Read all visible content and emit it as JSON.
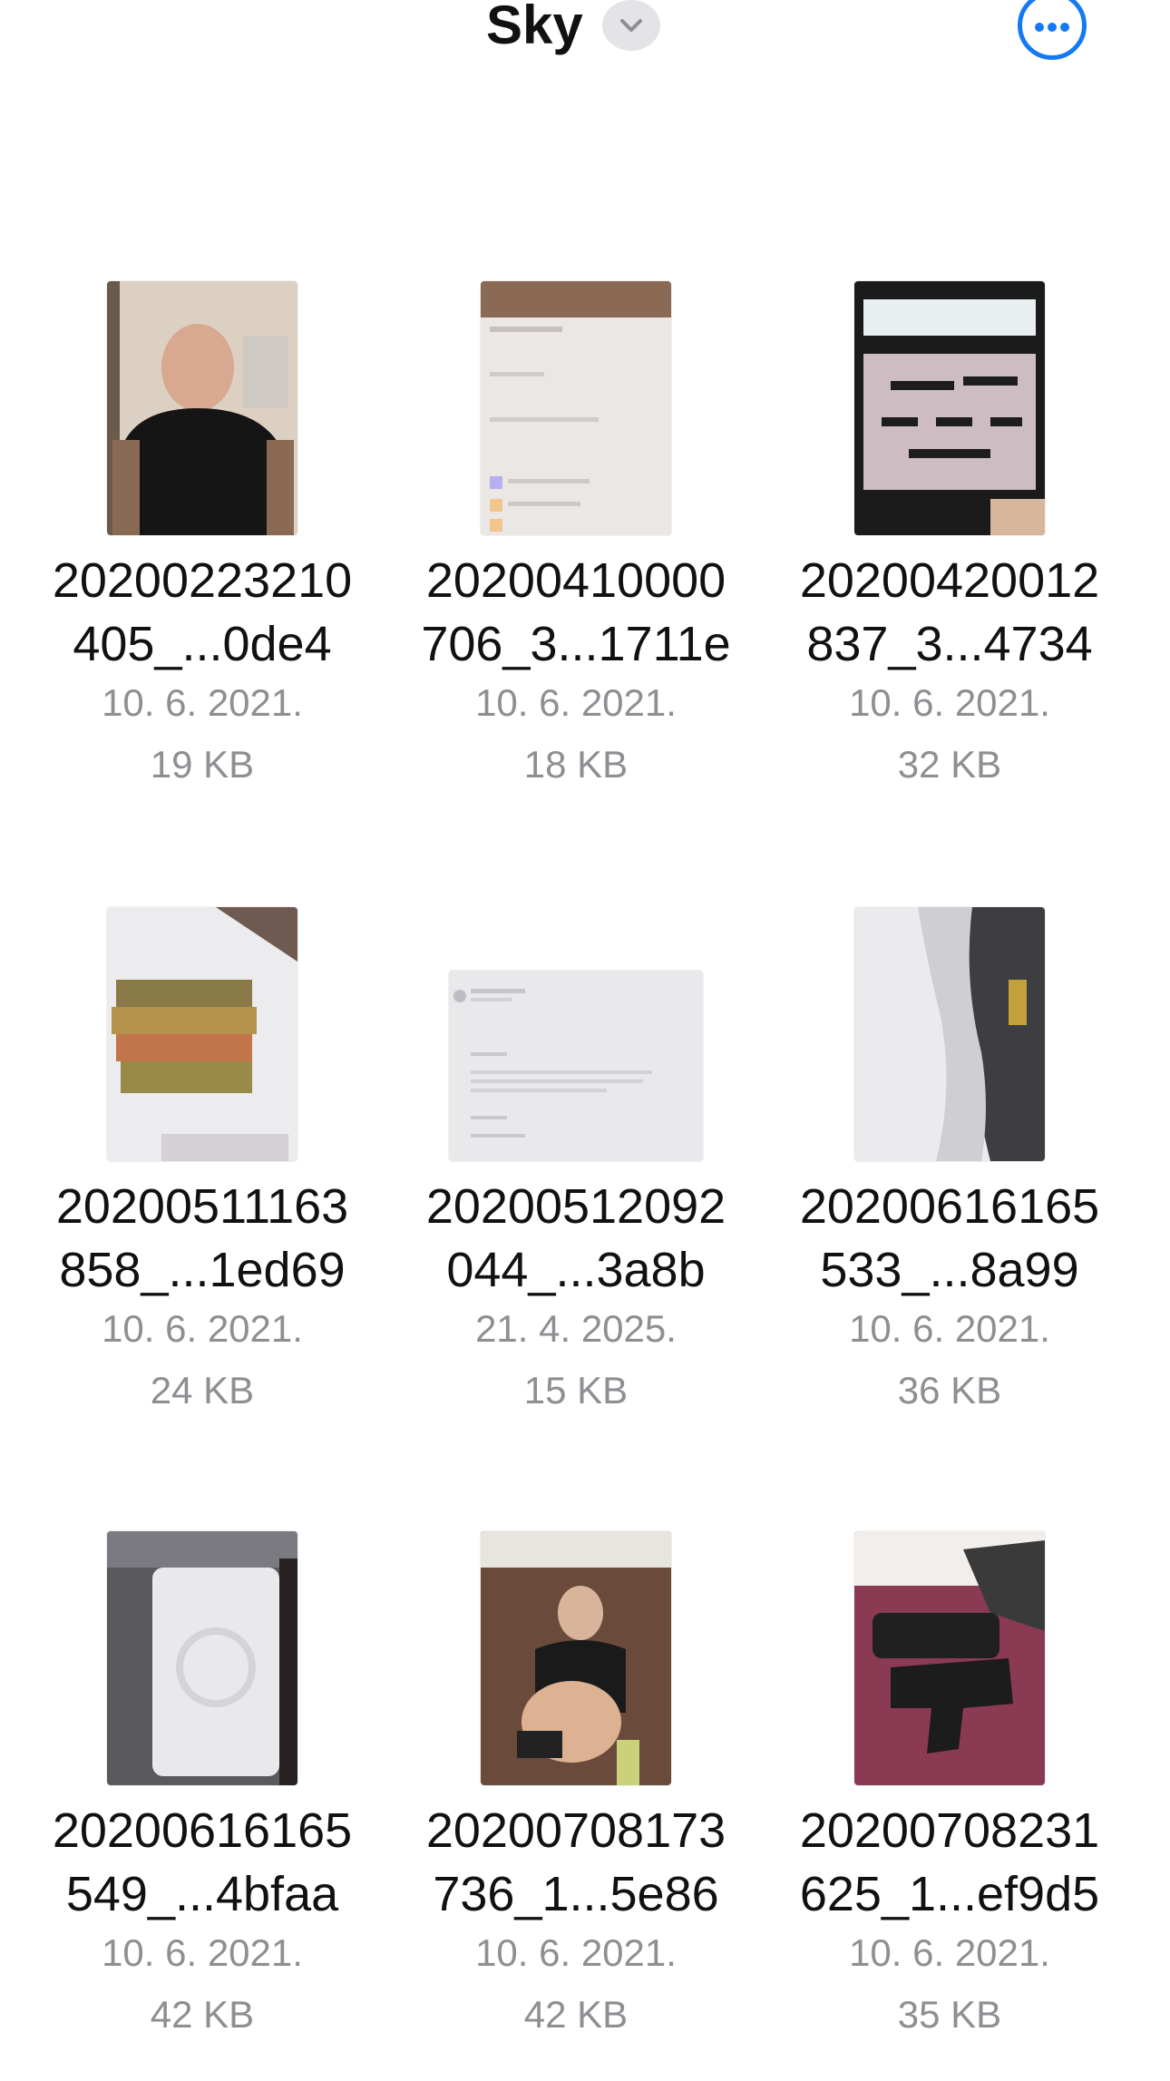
{
  "header": {
    "title": "Sky",
    "chevron_icon": "chevron-down-icon",
    "more_icon": "ellipsis-circle-icon",
    "accent_color": "#1479f5"
  },
  "files": [
    {
      "name_line1": "20200223210",
      "name_line2": "405_...0de4",
      "date": "10. 6. 2021.",
      "size": "19 KB",
      "thumbnail": "selfie-man-black-tshirt"
    },
    {
      "name_line1": "20200410000",
      "name_line2": "706_3...1711e",
      "date": "10. 6. 2021.",
      "size": "18 KB",
      "thumbnail": "phone-chat-screenshot"
    },
    {
      "name_line1": "20200420012",
      "name_line2": "837_3...4734",
      "date": "10. 6. 2021.",
      "size": "32 KB",
      "thumbnail": "phone-photo-weapons"
    },
    {
      "name_line1": "20200511163",
      "name_line2": "858_...1ed69",
      "date": "10. 6. 2021.",
      "size": "24 KB",
      "thumbnail": "cash-bundles"
    },
    {
      "name_line1": "20200512092",
      "name_line2": "044_...3a8b",
      "date": "21. 4. 2025.",
      "size": "15 KB",
      "thumbnail": "email-screenshot"
    },
    {
      "name_line1": "20200616165",
      "name_line2": "533_...8a99",
      "date": "10. 6. 2021.",
      "size": "36 KB",
      "thumbnail": "white-powder-block"
    },
    {
      "name_line1": "20200616165",
      "name_line2": "549_...4bfaa",
      "date": "10. 6. 2021.",
      "size": "42 KB",
      "thumbnail": "pressed-brick"
    },
    {
      "name_line1": "20200708173",
      "name_line2": "736_1...5e86",
      "date": "10. 6. 2021.",
      "size": "42 KB",
      "thumbnail": "bar-selfie-man"
    },
    {
      "name_line1": "20200708231",
      "name_line2": "625_1...ef9d5",
      "date": "10. 6. 2021.",
      "size": "35 KB",
      "thumbnail": "handgun-on-table"
    }
  ]
}
